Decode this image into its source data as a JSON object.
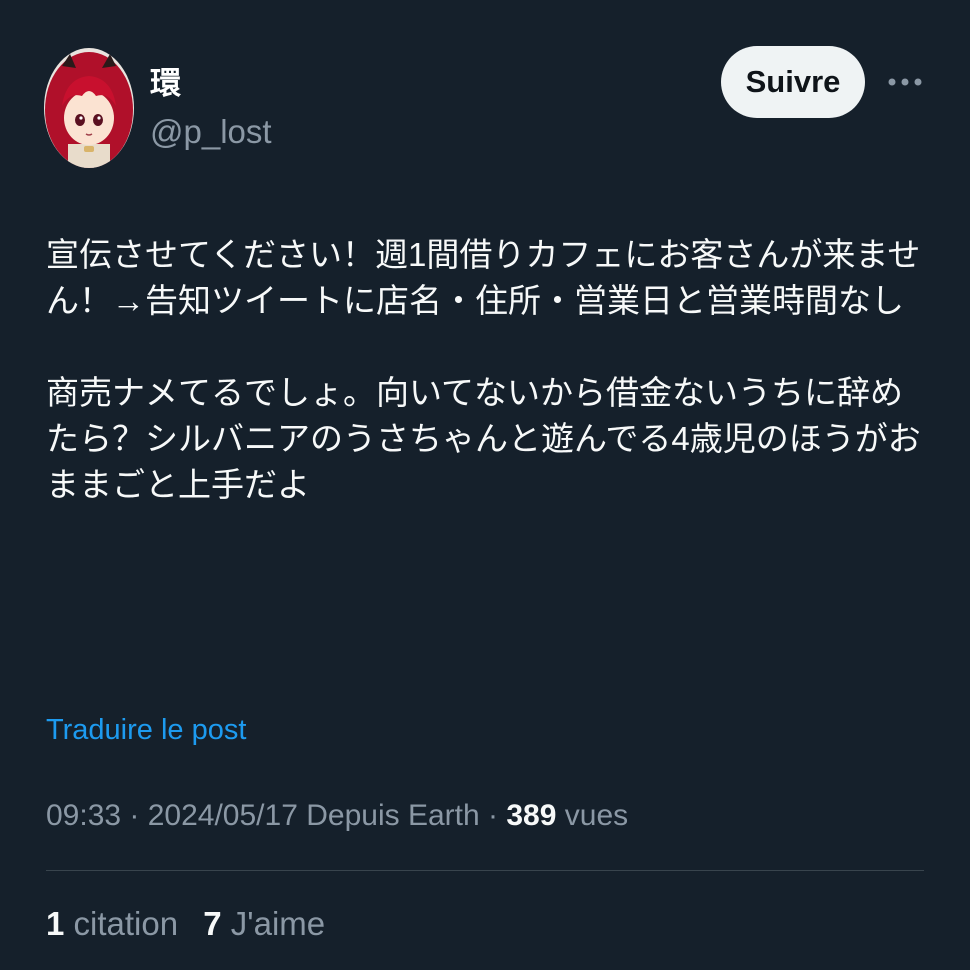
{
  "author": {
    "display_name": "環",
    "handle": "@p_lost"
  },
  "header": {
    "follow_label": "Suivre",
    "more_icon": "more-horizontal-icon"
  },
  "tweet": {
    "paragraphs": [
      "宣伝させてください！週1間借りカフェにお客さんが来ません！→告知ツイートに店名・住所・営業日と営業時間なし",
      "商売ナメてるでしょ。向いてないから借金ないうちに辞めたら？シルバニアのうさちゃんと遊んでる4歳児のほうがおままごと上手だよ"
    ],
    "translate_label": "Traduire le post"
  },
  "meta": {
    "time_date": "09:33 · 2024/05/17",
    "source": "Depuis Earth",
    "separator": "·",
    "views_count": "389",
    "views_label": "vues"
  },
  "stats": {
    "quotes_count": "1",
    "quotes_label": "citation",
    "likes_count": "7",
    "likes_label": "J'aime"
  },
  "colors": {
    "background": "#15202b",
    "text": "#f7f9f9",
    "muted": "#8b98a5",
    "link": "#1d9bf0",
    "button_bg": "#eff3f4"
  }
}
